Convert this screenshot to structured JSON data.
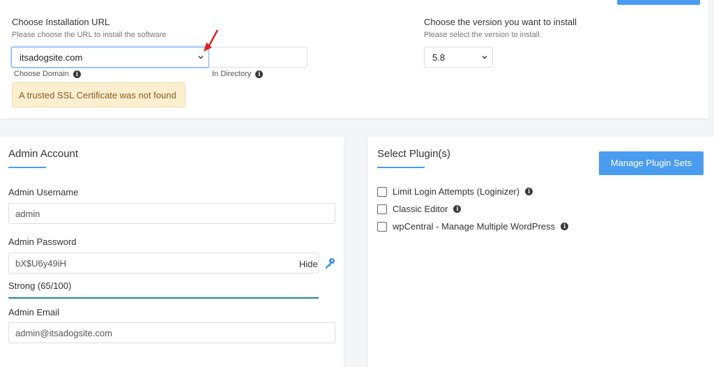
{
  "install_url": {
    "title": "Choose Installation URL",
    "subtitle": "Please choose the URL to install the software",
    "domain_value": "itsadogsite.com",
    "domain_hint": "Choose Domain",
    "directory_value": "",
    "directory_hint": "In Directory",
    "ssl_warning": "A trusted SSL Certificate was not found"
  },
  "version": {
    "title": "Choose the version you want to install",
    "subtitle": "Please select the version to install.",
    "selected": "5.8"
  },
  "admin_account": {
    "title": "Admin Account",
    "username_label": "Admin Username",
    "username_value": "admin",
    "password_label": "Admin Password",
    "password_value": "bX$U6y49iH",
    "hide_label": "Hide",
    "strength_text": "Strong (65/100)",
    "email_label": "Admin Email",
    "email_value": "admin@itsadogsite.com"
  },
  "plugins": {
    "title": "Select Plugin(s)",
    "manage_button": "Manage Plugin Sets",
    "items": [
      {
        "label": "Limit Login Attempts (Loginizer)",
        "checked": false
      },
      {
        "label": "Classic Editor",
        "checked": false
      },
      {
        "label": "wpCentral - Manage Multiple WordPress",
        "checked": false
      }
    ]
  },
  "icons": {
    "info": "info-icon",
    "chevron": "chevron-down-icon",
    "key": "key-icon",
    "arrow": "red-arrow-annotation"
  },
  "colors": {
    "accent": "#4a9cf0",
    "strength": "#1e8c86",
    "warning_bg": "#fcefd0",
    "warning_text": "#8a5a1a",
    "arrow": "#e02020"
  }
}
